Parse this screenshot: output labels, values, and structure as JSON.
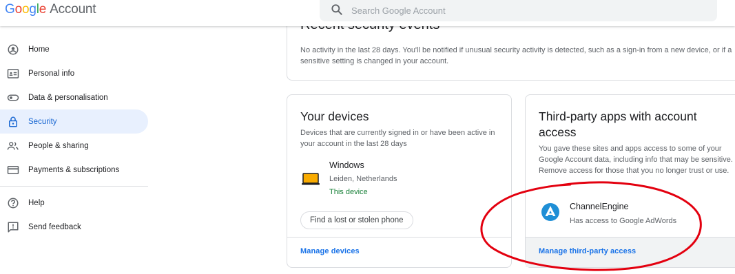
{
  "header": {
    "logo_letters": [
      "G",
      "o",
      "o",
      "g",
      "l",
      "e"
    ],
    "product": "Account",
    "search_placeholder": "Search Google Account"
  },
  "sidebar": {
    "items": [
      {
        "label": "Home",
        "icon": "home-icon",
        "active": false
      },
      {
        "label": "Personal info",
        "icon": "id-card-icon",
        "active": false
      },
      {
        "label": "Data & personalisation",
        "icon": "toggle-icon",
        "active": false
      },
      {
        "label": "Security",
        "icon": "lock-icon",
        "active": true
      },
      {
        "label": "People & sharing",
        "icon": "people-icon",
        "active": false
      },
      {
        "label": "Payments & subscriptions",
        "icon": "credit-card-icon",
        "active": false
      }
    ],
    "secondary": [
      {
        "label": "Help",
        "icon": "help-icon"
      },
      {
        "label": "Send feedback",
        "icon": "feedback-icon"
      }
    ]
  },
  "events": {
    "title": "Recent security events",
    "text": "No activity in the last 28 days. You'll be notified if unusual security activity is detected, such as a sign-in from a new device, or if a sensitive setting is changed in your account."
  },
  "devices": {
    "title": "Your devices",
    "description": "Devices that are currently signed in or have been active in your account in the last 28 days",
    "device_name": "Windows",
    "device_location": "Leiden, Netherlands",
    "device_status": "This device",
    "lost_button": "Find a lost or stolen phone",
    "manage_link": "Manage devices"
  },
  "apps": {
    "title": "Third-party apps with account access",
    "description": "You gave these sites and apps access to some of your Google Account data, including info that may be sensitive. Remove access for those that you no longer trust or use.",
    "app_name": "ChannelEngine",
    "app_access": "Has access to Google AdWords",
    "manage_link": "Manage third-party access"
  },
  "colors": {
    "accent": "#1a73e8",
    "active_bg": "#e8f0fe",
    "annotation": "#e3000f",
    "success": "#188038"
  }
}
